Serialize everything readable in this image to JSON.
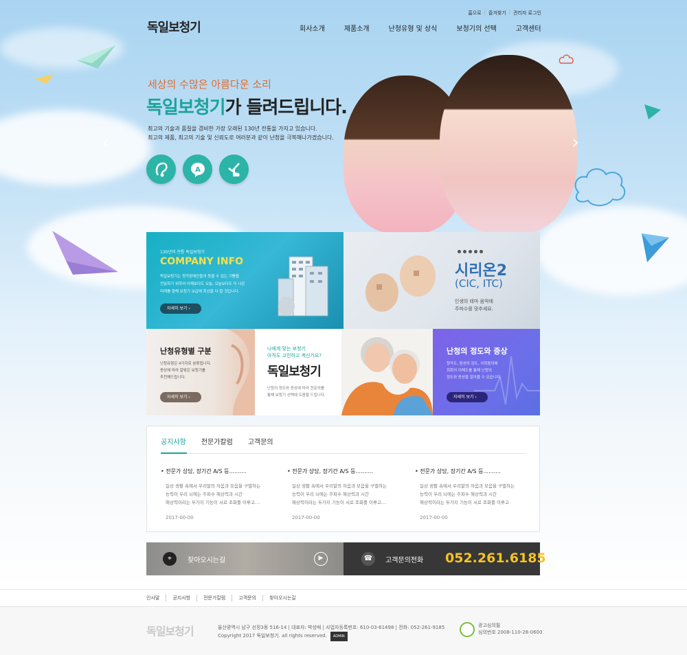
{
  "topbar": {
    "links": [
      "홈으로",
      "즐겨찾기",
      "관리자 로그인"
    ]
  },
  "header": {
    "logo": "독일보청기",
    "nav": [
      "회사소개",
      "제품소개",
      "난청유형 및 상식",
      "보청기의 선택",
      "고객센터"
    ]
  },
  "hero": {
    "subtitle": "세상의 수많은 아름다운 소리",
    "title_accent": "독일보청기",
    "title_rest": "가 들려드립니다.",
    "desc_line1": "최고의 기술과 품질을 겸비한 가장 오래된 130년 전통을 가지고 있습니다.",
    "desc_line2": "최고의 제품, 최고의 기술 및 신뢰도로 여러분과 같이 난청을 극복해나가겠습니다.",
    "icons": [
      "hearing-aid-icon",
      "a-letter-icon",
      "touch-hand-icon"
    ],
    "icon_glyphs": [
      "Ɑ",
      "A",
      "✓"
    ]
  },
  "banners": {
    "company": {
      "eyebrow": "130년의 전통 독일보청기",
      "title": "COMPANY INFO",
      "desc1": "독일보청기는 청각장애인들의 등을 수 있는 기쁨을",
      "desc2": "전달하기 위하여 어제보다도 오늘, 오늘보다도 더 나은",
      "desc3": "미래를 향해 보청기 보급에 최선을 다 할 것입니다.",
      "button": "자세히 보기"
    },
    "product": {
      "title": "시리온2",
      "model": "(CIC, ITC)",
      "desc1": "인생의 테마 음악에",
      "desc2": "주파수를 맞추세요."
    },
    "type": {
      "title": "난청유형별 구분",
      "desc1": "난청유형은 4가지로 분류됩니다.",
      "desc2": "증상에 따라 알맞은 보청기를",
      "desc3": "추천해드립니다.",
      "button": "자세히 보기"
    },
    "choose": {
      "q1": "나에게 맞는 보청기",
      "q2": "아직도 고민하고 계신가요?",
      "title": "독일보청기",
      "desc1": "난청의 정도와 증상에 따라 전문의를",
      "desc2": "통해 보청기 선택에 도움을 드립니다."
    },
    "degree": {
      "title": "난청의 정도와 증상",
      "desc1": "청각도, 음성의 감도, 사회음의에",
      "desc2": "회화의 이해도를 통해 난청의",
      "desc3": "정도와 증상을 알아볼 수 있습니다.",
      "button": "자세히 보기"
    }
  },
  "news": {
    "tabs": [
      "공지사항",
      "전문가칼럼",
      "고객문의"
    ],
    "articles": [
      {
        "title": "전문가 상담, 장기간 A/S 등..........",
        "l1": "일상 생활 속에서 우리말의 자음과 모음을 구별하는",
        "l2": "능력이 우리 뇌에는 주파수 해상력과 시간",
        "l3": "해상력이라는 두가지 기능이 서로 조화를 이루고....",
        "date": "2017-00-00"
      },
      {
        "title": "전문가 상담, 장기간 A/S 등..........",
        "l1": "일상 생활 속에서 우리말의 자음과 모음을 구별하는",
        "l2": "능력이 우리 뇌에는 주파수 해상력과 시간",
        "l3": "해상력이라는 두가지 기능이 서로 조화를 이루고....",
        "date": "2017-00-00"
      },
      {
        "title": "전문가 상담, 장기간 A/S 등..........",
        "l1": "일상 생활 속에서 우리말의 자음과 모음을 구별하는",
        "l2": "능력이 우리 뇌에는 주파수 해상력과 시간",
        "l3": "해상력이라는 두가지 기능이 서로 조화를 이루고",
        "date": "2017-00-00"
      }
    ]
  },
  "info": {
    "map_label": "찾아오시는길",
    "tel_label": "고객문의전화",
    "tel": "052.261.6185"
  },
  "footer_nav": [
    "인사말",
    "공지사항",
    "전문가칼럼",
    "고객문의",
    "찾아오시는길"
  ],
  "footer": {
    "logo": "독일보청기",
    "address": "울산광역시 남구 선정3동 516-14 | 대표자: 박성배 | 사업자등록번호: 610-03-61498 | 전화: 052-261-9185",
    "copyright": "Copyright 2017 독일보청기. all rights reserved.",
    "admin": "ADMIN",
    "seal_title": "광고심의필",
    "seal_no": "심의번호 2008-110-28-0600"
  },
  "colors": {
    "accent": "#1aa39a",
    "orange": "#e26a2c",
    "tel_yellow": "#f7c325"
  }
}
